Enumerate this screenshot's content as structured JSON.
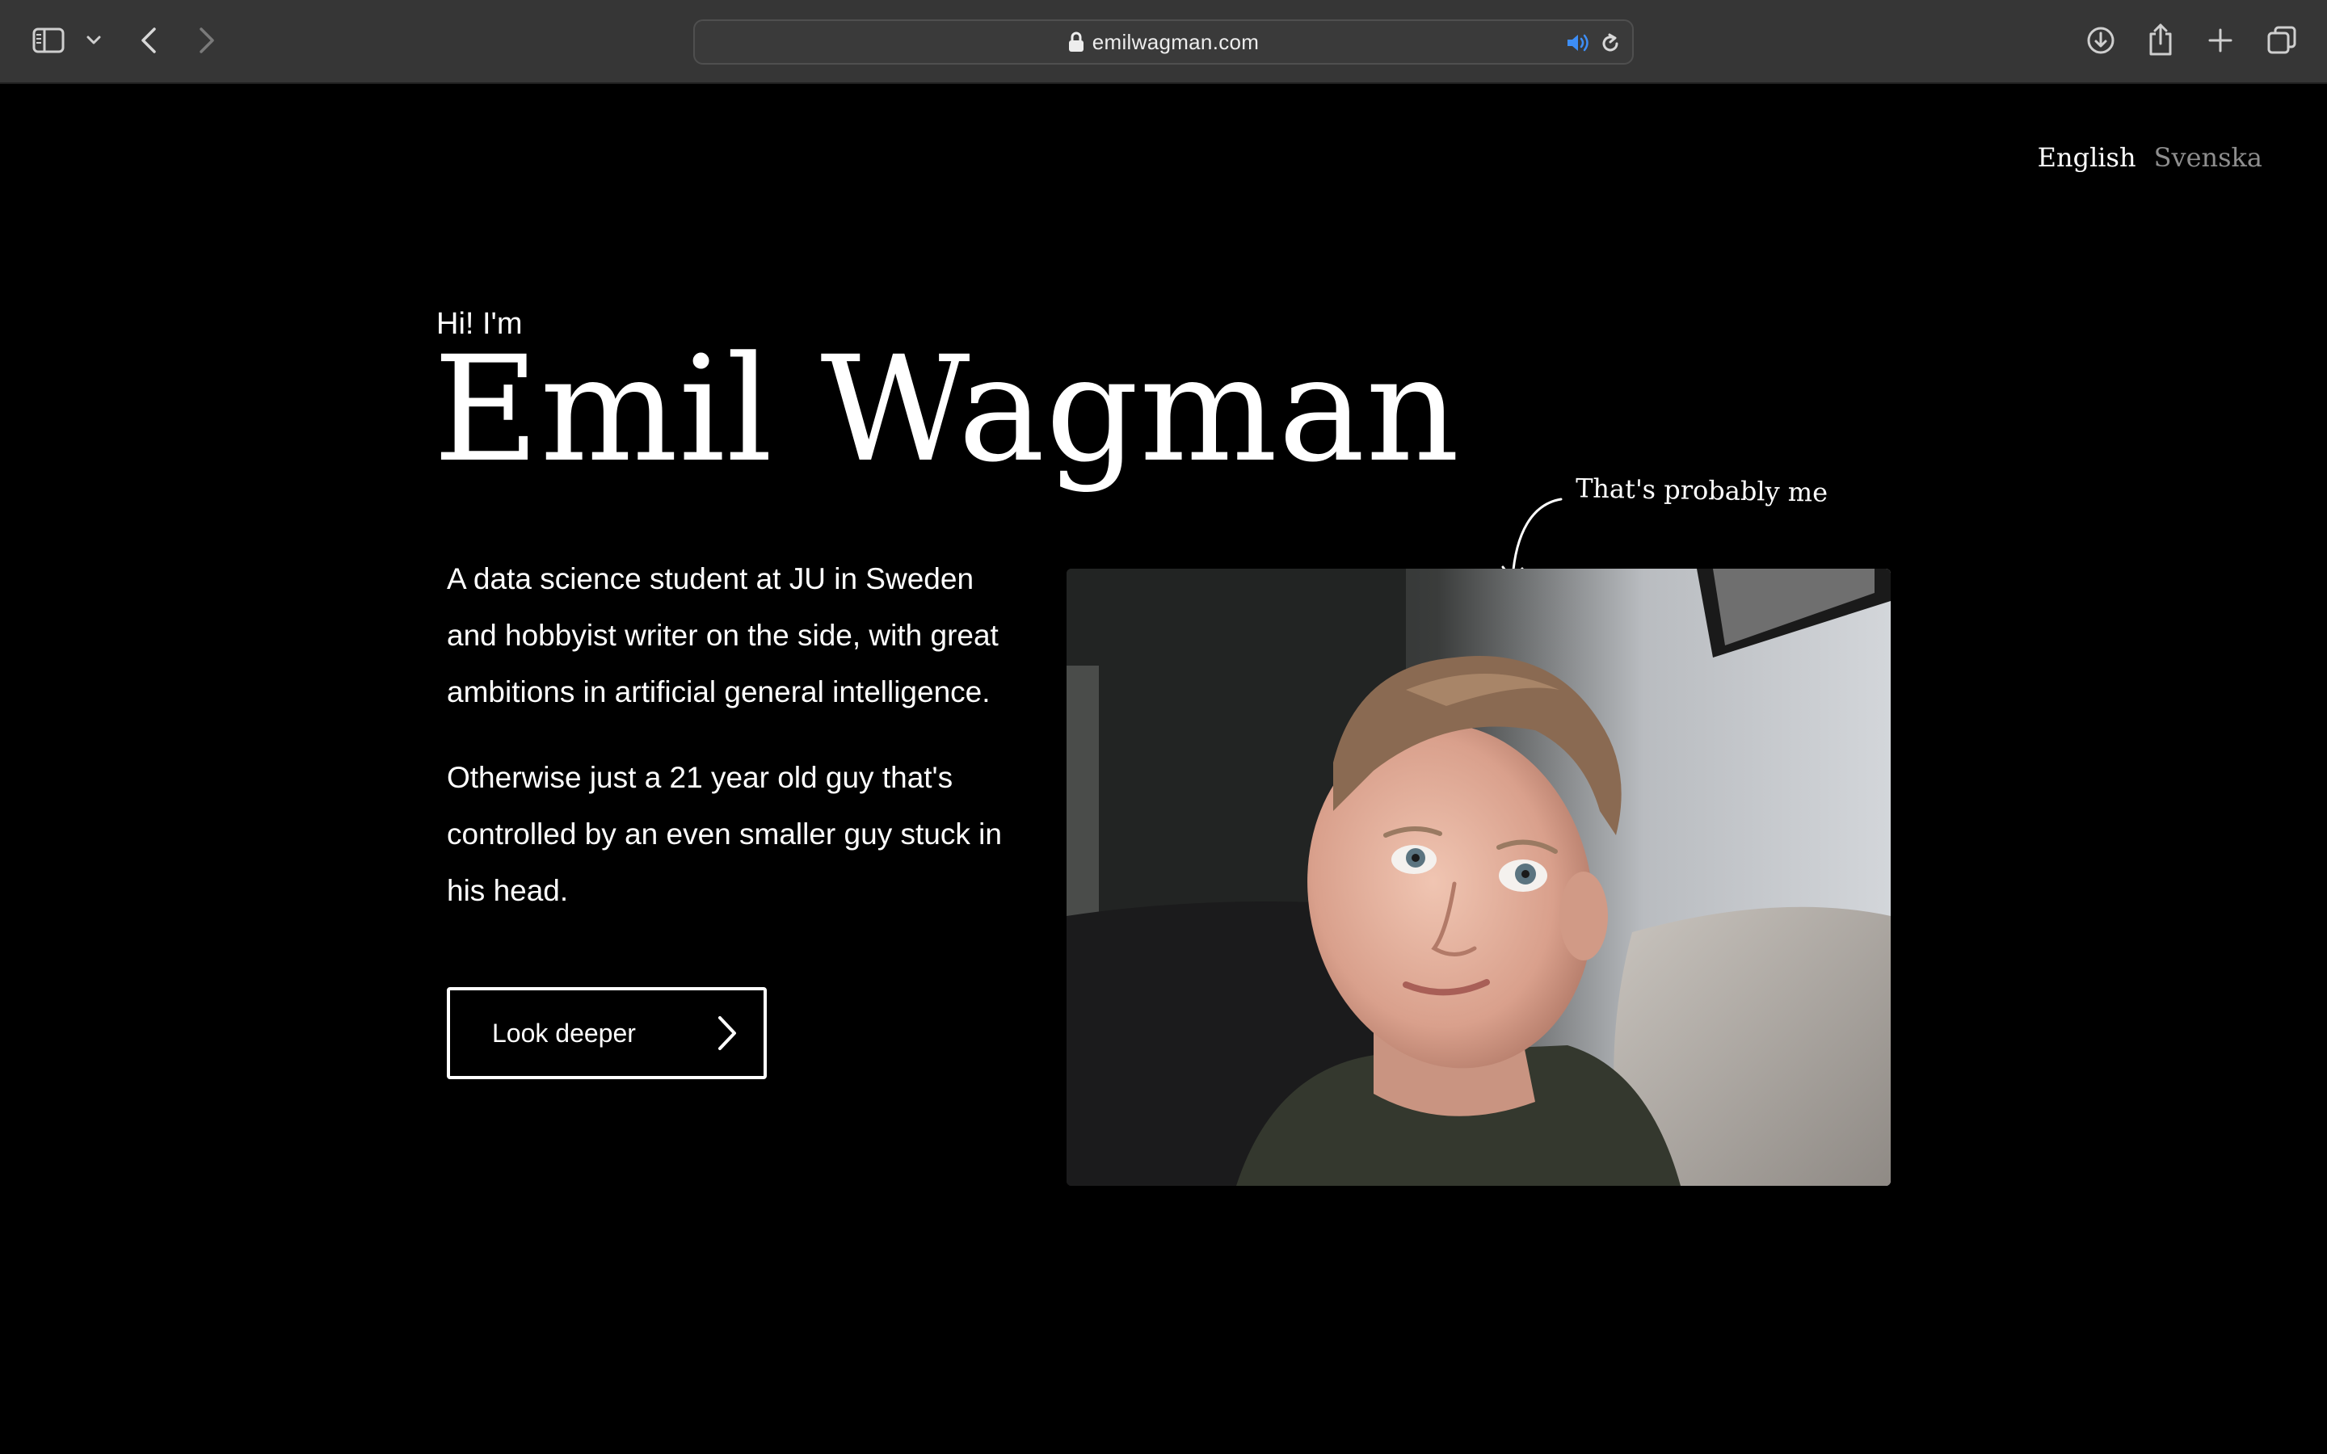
{
  "browser": {
    "url": "emilwagman.com",
    "icons": {
      "sidebar": "sidebar-icon",
      "dropdown": "chevron-down-icon",
      "back": "chevron-left-icon",
      "forward": "chevron-right-icon",
      "lock": "lock-icon",
      "audio": "speaker-icon",
      "reload": "reload-icon",
      "downloads": "download-icon",
      "share": "share-icon",
      "new_tab": "plus-icon",
      "tabs": "tabs-overview-icon"
    },
    "accent_color": "#3d8ef7"
  },
  "lang": {
    "english": "English",
    "svenska": "Svenska"
  },
  "hero": {
    "greeting": "Hi! I'm",
    "name": "Emil Wagman",
    "bio_1": "A data science student at JU in Sweden and hobbyist writer on the side, with great ambitions in artificial general intelligence.",
    "bio_2": "Otherwise just a 21 year old guy that's controlled by an even smaller guy stuck in his head.",
    "cta_label": "Look deeper"
  },
  "photo": {
    "caption": "That's probably me"
  },
  "colors": {
    "background": "#000000",
    "text": "#ffffff",
    "muted": "#8e8e8e",
    "chrome": "#363636"
  }
}
